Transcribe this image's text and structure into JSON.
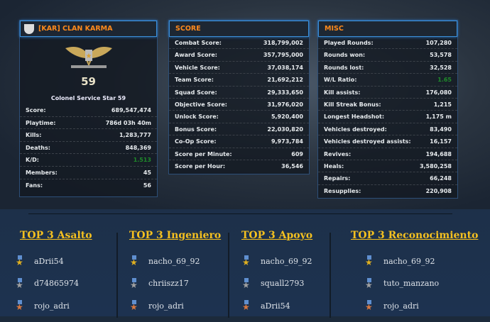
{
  "clan": {
    "name": "[KAR] CLAN KARMA",
    "rank_number": "59",
    "rank_name": "Colonel Service Star 59",
    "stats": [
      {
        "label": "Score:",
        "value": "689,547,474"
      },
      {
        "label": "Playtime:",
        "value": "786d 03h 40m"
      },
      {
        "label": "Kills:",
        "value": "1,283,777"
      },
      {
        "label": "Deaths:",
        "value": "848,369"
      },
      {
        "label": "K/D:",
        "value": "1.513"
      },
      {
        "label": "Members:",
        "value": "45"
      },
      {
        "label": "Fans:",
        "value": "56"
      }
    ]
  },
  "score": {
    "title": "SCORE",
    "rows": [
      {
        "label": "Combat Score:",
        "value": "318,799,002"
      },
      {
        "label": "Award Score:",
        "value": "357,795,000"
      },
      {
        "label": "Vehicle Score:",
        "value": "37,038,174"
      },
      {
        "label": "Team Score:",
        "value": "21,692,212"
      },
      {
        "label": "Squad Score:",
        "value": "29,333,650"
      },
      {
        "label": "Objective Score:",
        "value": "31,976,020"
      },
      {
        "label": "Unlock Score:",
        "value": "5,920,400"
      },
      {
        "label": "Bonus Score:",
        "value": "22,030,820"
      },
      {
        "label": "Co-Op Score:",
        "value": "9,973,784"
      },
      {
        "label": "Score per Minute:",
        "value": "609"
      },
      {
        "label": "Score per Hour:",
        "value": "36,546"
      }
    ]
  },
  "misc": {
    "title": "MISC",
    "rows": [
      {
        "label": "Played Rounds:",
        "value": "107,280"
      },
      {
        "label": "Rounds won:",
        "value": "53,578"
      },
      {
        "label": "Rounds lost:",
        "value": "32,528"
      },
      {
        "label": "W/L Ratio:",
        "value": "1.65"
      },
      {
        "label": "Kill assists:",
        "value": "176,080"
      },
      {
        "label": "Kill Streak Bonus:",
        "value": "1,215"
      },
      {
        "label": "Longest Headshot:",
        "value": "1,175 m"
      },
      {
        "label": "Vehicles destroyed:",
        "value": "83,490"
      },
      {
        "label": "Vehicles destroyed assists:",
        "value": "16,157"
      },
      {
        "label": "Revives:",
        "value": "194,688"
      },
      {
        "label": "Heals:",
        "value": "3,580,258"
      },
      {
        "label": "Repairs:",
        "value": "66,248"
      },
      {
        "label": "Resupplies:",
        "value": "220,908"
      }
    ]
  },
  "tops": [
    {
      "title": "TOP 3 Asalto",
      "players": [
        "aDrii54",
        "d74865974",
        "rojo_adri"
      ]
    },
    {
      "title": "TOP 3 Ingeniero",
      "players": [
        "nacho_69_92",
        "chriiszz17",
        "rojo_adri"
      ]
    },
    {
      "title": "TOP 3 Apoyo",
      "players": [
        "nacho_69_92",
        "squall2793",
        "aDrii54"
      ]
    },
    {
      "title": "TOP 3 Reconocimiento",
      "players": [
        "nacho_69_92",
        "tuto_manzano",
        "rojo_adri"
      ]
    }
  ],
  "colors": {
    "accent": "#ff8a1c",
    "gold": "#f4c020",
    "positive": "#1f8a2a",
    "medal_gold": "#e0b020",
    "medal_silver": "#a0a0a0",
    "medal_bronze": "#d87840"
  }
}
